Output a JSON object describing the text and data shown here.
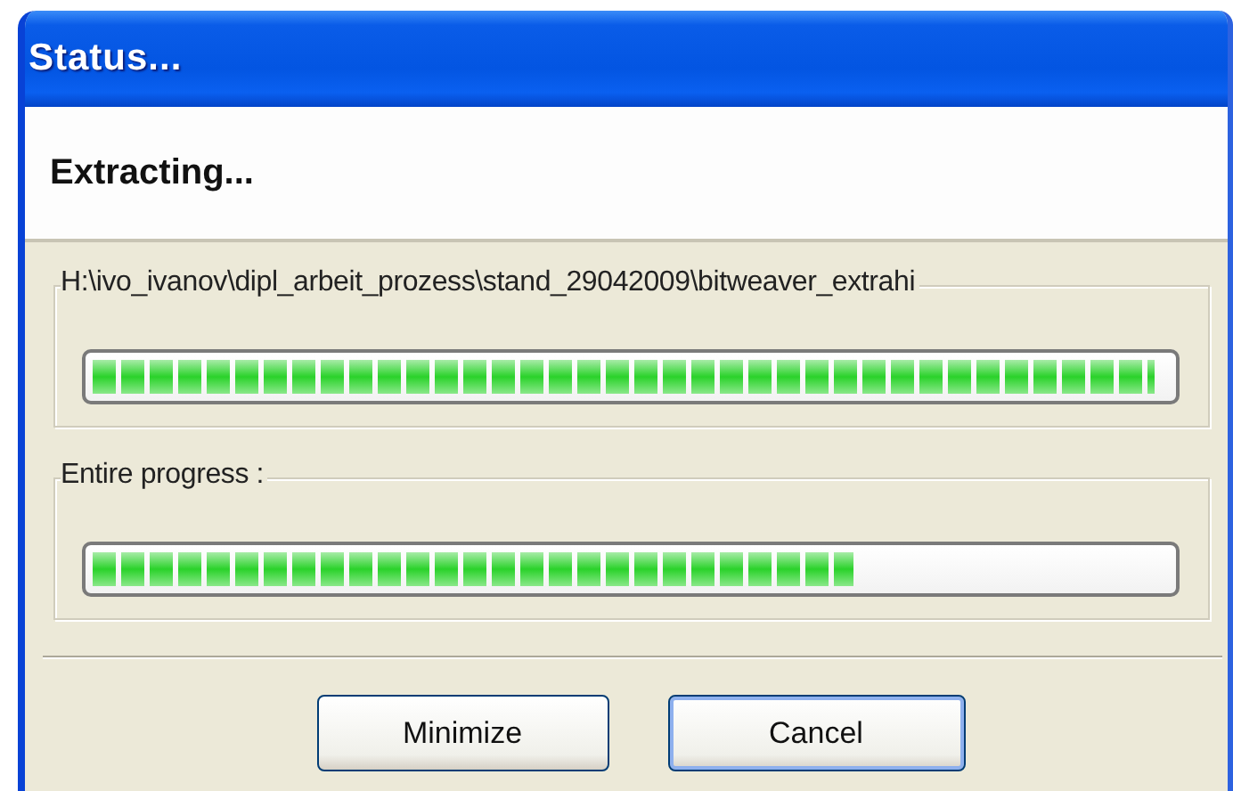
{
  "window": {
    "title": "Status..."
  },
  "header": {
    "heading": "Extracting..."
  },
  "groups": [
    {
      "label": "H:\\ivo_ivanov\\dipl_arbeit_prozess\\stand_29042009\\bitweaver_extrahi",
      "level": 1.0
    },
    {
      "label": "Entire progress :",
      "level": 0.72
    }
  ],
  "buttons": [
    {
      "label": "Minimize",
      "focused": false
    },
    {
      "label": "Cancel",
      "focused": true
    }
  ]
}
